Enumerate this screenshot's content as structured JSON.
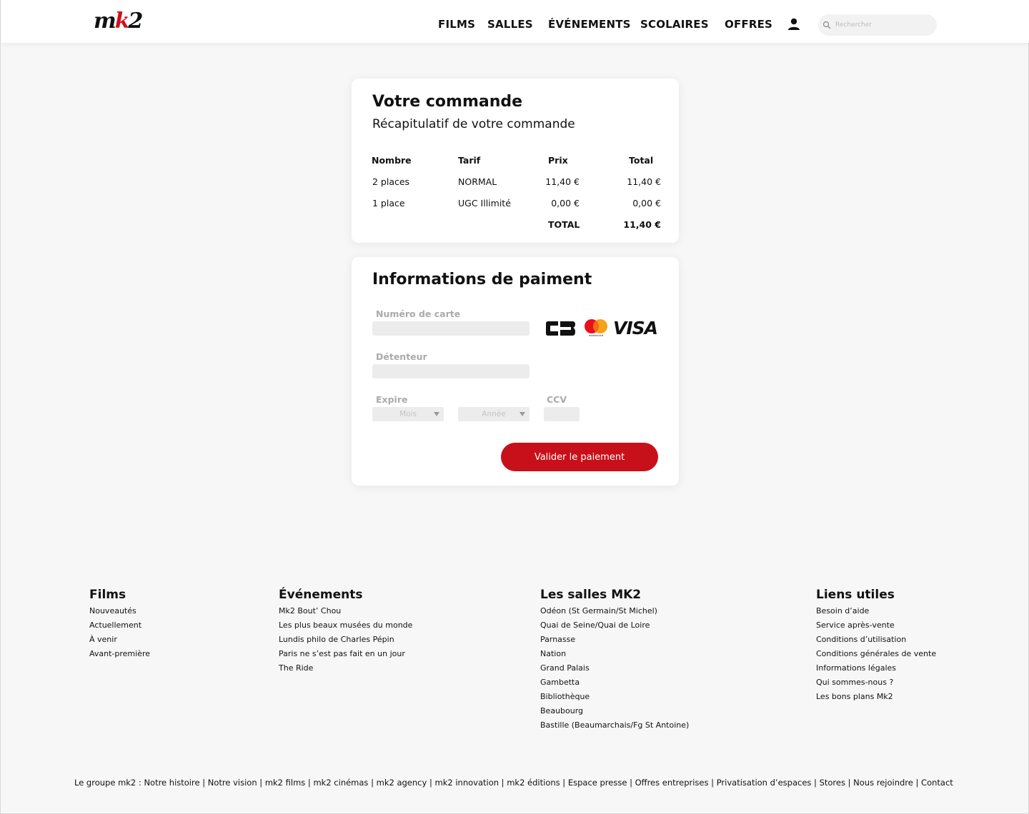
{
  "header": {
    "logo": {
      "m": "m",
      "k": "k",
      "two": "2"
    },
    "nav": [
      "FILMS",
      "SALLES",
      "ÉVÉNEMENTS",
      "SCOLAIRES",
      "OFFRES"
    ],
    "search_placeholder": "Rechercher"
  },
  "order": {
    "title": "Votre commande",
    "subtitle": "Récapitulatif  de votre commande",
    "columns": [
      "Nombre",
      "Tarif",
      "Prix",
      "Total"
    ],
    "rows": [
      {
        "nombre": "2 places",
        "tarif": "NORMAL",
        "prix": "11,40 €",
        "total": "11,40 €"
      },
      {
        "nombre": "1 place",
        "tarif": "UGC Illimité",
        "prix": "0,00 €",
        "total": "0,00 €"
      }
    ],
    "total_label": "TOTAL",
    "total_value": "11,40 €"
  },
  "payment": {
    "title": "Informations de paiment",
    "card_number_label": "Numéro de carte",
    "holder_label": "Détenteur",
    "expiry_label": "Expire",
    "month_placeholder": "Mois",
    "year_placeholder": "Année",
    "ccv_label": "CCV",
    "submit_label": "Valider le paiement",
    "card_logos": {
      "visa": "VISA",
      "mastercard_caption": "mastercard"
    }
  },
  "footer": {
    "columns": [
      {
        "title": "Films",
        "links": [
          "Nouveautés",
          "Actuellement",
          "À venir",
          "Avant-première"
        ]
      },
      {
        "title": "Événements",
        "links": [
          "Mk2 Bout’ Chou",
          "Les plus beaux musées du monde",
          "Lundis philo de Charles Pépin",
          "Paris ne s’est pas fait en un jour",
          "The Ride"
        ]
      },
      {
        "title": "Les salles MK2",
        "links": [
          "Odéon (St Germain/St Michel)",
          "Quai de Seine/Quai de Loire",
          "Parnasse",
          "Nation",
          "Grand Palais",
          "Gambetta",
          "Bibliothèque",
          "Beaubourg",
          "Bastille (Beaumarchais/Fg St Antoine)"
        ]
      },
      {
        "title": "Liens utiles",
        "links": [
          "Besoin d’aide",
          "Service après-vente",
          "Conditions d’utilisation",
          "Conditions générales de vente",
          "Informations légales",
          "Qui sommes-nous ?",
          "Les bons plans Mk2"
        ]
      }
    ],
    "bottom_prefix": "Le groupe mk2 :",
    "bottom_links": [
      "Notre histoire",
      "Notre vision",
      "mk2 films",
      "mk2 cinémas",
      "mk2 agency",
      "mk2 innovation",
      "mk2 éditions",
      "Espace presse",
      "Offres entreprises",
      "Privatisation d’espaces",
      "Stores",
      "Nous rejoindre",
      "Contact"
    ]
  },
  "colors": {
    "accent": "#c8101a",
    "background": "#f7f7f7",
    "card": "#ffffff",
    "input": "#ececec"
  }
}
